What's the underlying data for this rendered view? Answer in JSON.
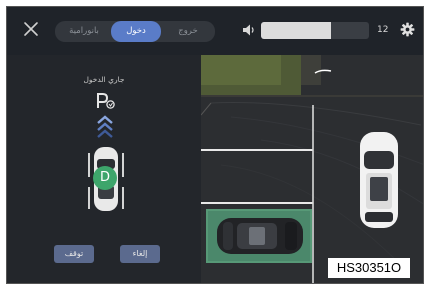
{
  "topbar": {
    "modes": [
      "بانورامية",
      "دخول",
      "خروج"
    ],
    "active_mode": "دخول",
    "volume": {
      "value": "12",
      "fraction": 0.65
    }
  },
  "parking": {
    "status": "جاري الدخول",
    "gear": "D",
    "buttons": {
      "pause": "توقف",
      "cancel": "إلغاء"
    }
  },
  "figure_code": "HS30351O",
  "colors": {
    "accent": "#5a7cc8",
    "guide": "#3da56b",
    "button": "#5b6a8e"
  }
}
